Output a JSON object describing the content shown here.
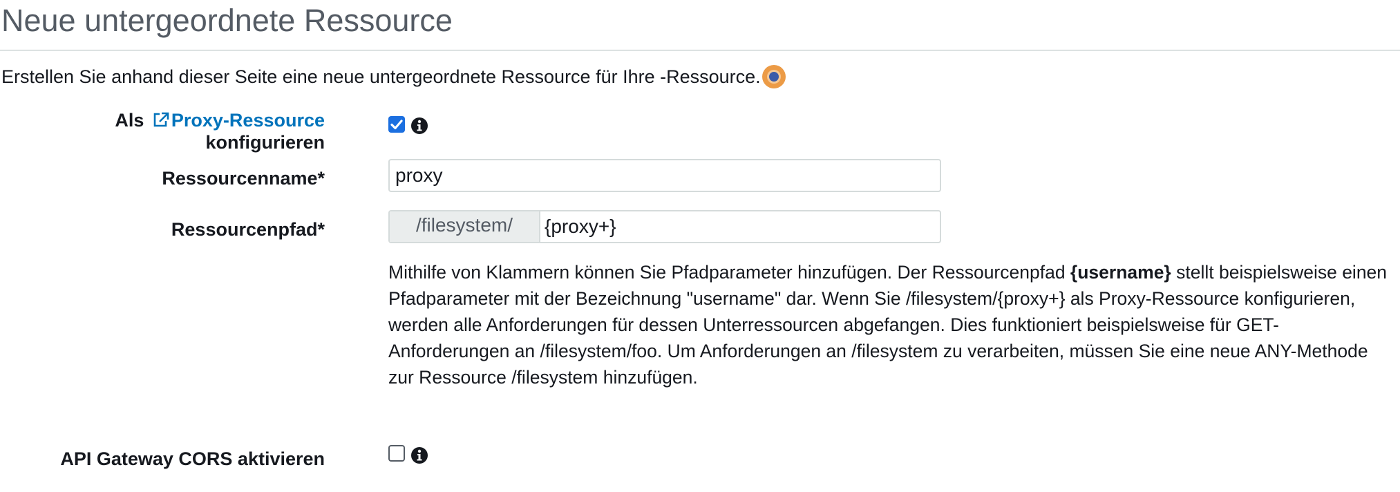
{
  "page": {
    "title": "Neue untergeordnete Ressource",
    "intro": "Erstellen Sie anhand dieser Seite eine neue untergeordnete Ressource für Ihre -Ressource."
  },
  "form": {
    "proxy": {
      "label_prefix": "Als",
      "label_link": "Proxy-Ressource",
      "label_suffix": "konfigurieren",
      "checked": true
    },
    "resource_name": {
      "label": "Ressourcenname*",
      "value": "proxy"
    },
    "resource_path": {
      "label": "Ressourcenpfad*",
      "prefix": "/filesystem/",
      "value": "{proxy+}"
    },
    "help": {
      "part1": "Mithilfe von Klammern können Sie Pfadparameter hinzufügen. Der Ressourcenpfad ",
      "bold": "{username}",
      "part2": " stellt beispielsweise einen Pfadparameter mit der Bezeichnung \"username\" dar. Wenn Sie /filesystem/{proxy+} als Proxy-Ressource konfigurieren, werden alle Anforderungen für dessen Unterressourcen abgefangen. Dies funktioniert beispielsweise für GET-Anforderungen an /filesystem/foo. Um Anforderungen an /filesystem zu verarbeiten, müssen Sie eine neue ANY-Methode zur Ressource /filesystem hinzufügen."
    },
    "cors": {
      "label": "API Gateway CORS aktivieren",
      "checked": false
    }
  },
  "icons": {
    "external_link": "external-link-icon",
    "info": "info-icon",
    "help": "help-icon"
  },
  "colors": {
    "link": "#0073bb",
    "checkbox_checked": "#1b6fe0",
    "help_badge": "#ec9b46"
  }
}
